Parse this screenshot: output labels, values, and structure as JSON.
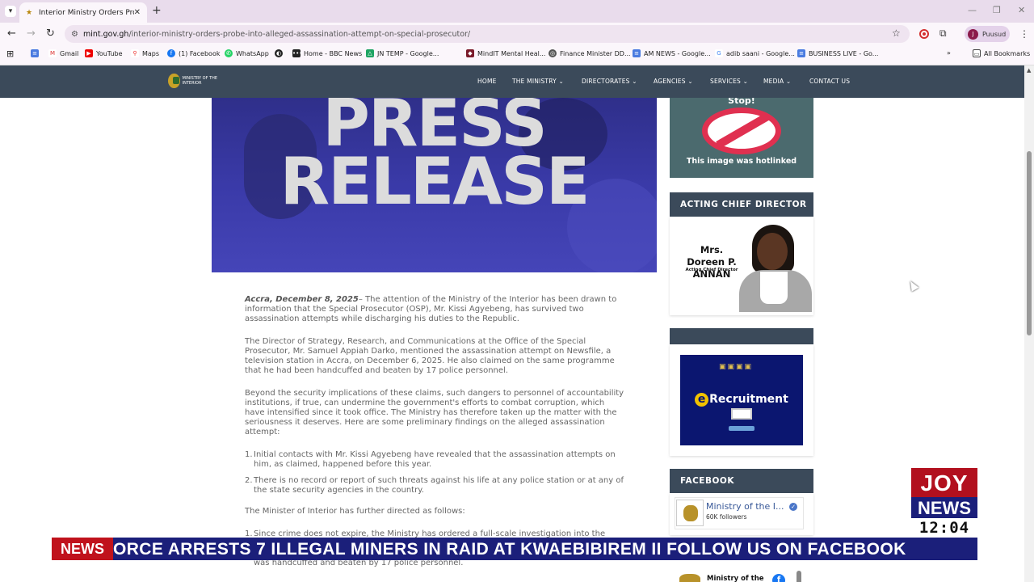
{
  "browser": {
    "tab_title": "Interior Ministry Orders Probe i",
    "url_host": "mint.gov.gh",
    "url_path": "/interior-ministry-orders-probe-into-alleged-assassination-attempt-on-special-prosecutor/",
    "profile_initial": "J",
    "profile_name": "Puusud",
    "bookmarks": [
      "Gmail",
      "YouTube",
      "Maps",
      "(1) Facebook",
      "WhatsApp",
      "",
      "Home - BBC News",
      "JN TEMP - Google...",
      "MindIT Mental Heal...",
      "Finance Minister DD...",
      "AM NEWS - Google...",
      "adib saani - Google...",
      "BUSINESS LIVE - Go..."
    ],
    "all_bookmarks": "All Bookmarks"
  },
  "site": {
    "logo_text": "MINISTRY OF THE INTERIOR",
    "nav": [
      "HOME",
      "THE MINISTRY",
      "DIRECTORATES",
      "AGENCIES",
      "SERVICES",
      "MEDIA",
      "CONTACT US"
    ],
    "nav_dropdown": [
      false,
      true,
      true,
      true,
      true,
      true,
      false
    ]
  },
  "hero": {
    "line1": "PRESS",
    "line2": "RELEASE"
  },
  "article": {
    "dateline": "Accra, December 8, 2025",
    "p1": "– The attention of the Ministry of the Interior has been drawn to information that the Special Prosecutor (OSP), Mr. Kissi Agyebeng, has survived two assassination attempts while discharging his duties to the Republic.",
    "p2": "The Director of Strategy, Research, and Communications at the Office of the Special Prosecutor, Mr. Samuel Appiah Darko, mentioned the assassination attempt on Newsfile, a television station in Accra, on December 6, 2025. He also claimed on the same programme that he had been handcuffed and beaten by 17 police personnel.",
    "p3": "Beyond the security implications of these claims, such dangers to personnel of accountability institutions, if true, can undermine the government's efforts to combat corruption, which have intensified since it took office. The Ministry has therefore taken up the matter with the seriousness it deserves. Here are some preliminary findings on the alleged assassination attempt:",
    "list1": [
      "Initial contacts with Mr. Kissi Agyebeng have revealed that the assassination attempts on him, as claimed, happened before this year.",
      "There is no record or report of such threats against his life at any police station or at any of the state security agencies in the country."
    ],
    "p4": "The Minister of Interior has further directed as follows:",
    "list2": [
      "Since crime does not expire, the Ministry has ordered a full-scale investigation into the claim of"
    ],
    "list2_tail": "was handcuffed and beaten by 17 police personnel."
  },
  "sidebar": {
    "hotlink_stop": "Stop!",
    "hotlink_text": "This image was hotlinked",
    "director_heading": "ACTING CHIEF DIRECTOR",
    "director_name": "Mrs. Doreen P. ANNAN",
    "director_role": "Acting Chief Director",
    "blank_heading": "",
    "erecruit_text": "Recruitment",
    "erecruit_e": "e",
    "facebook_heading": "FACEBOOK",
    "fb_page_name": "Ministry of the I...",
    "fb_followers": "60K followers",
    "fb_mini_name": "Ministry of the"
  },
  "overlay": {
    "ticker_tag": "NEWS",
    "ticker_text": "ORCE ARRESTS 7 ILLEGAL MINERS IN RAID AT KWAEBIBIREM     II     FOLLOW US ON FACEBOOK",
    "joy_top": "JOY",
    "joy_news": "NEWS",
    "clock": "12:04"
  },
  "colors": {
    "site_nav": "#3b4a5a",
    "ticker_bg": "#1b1f7a",
    "ticker_tag": "#c0121c",
    "joy_red": "#b2101e"
  }
}
